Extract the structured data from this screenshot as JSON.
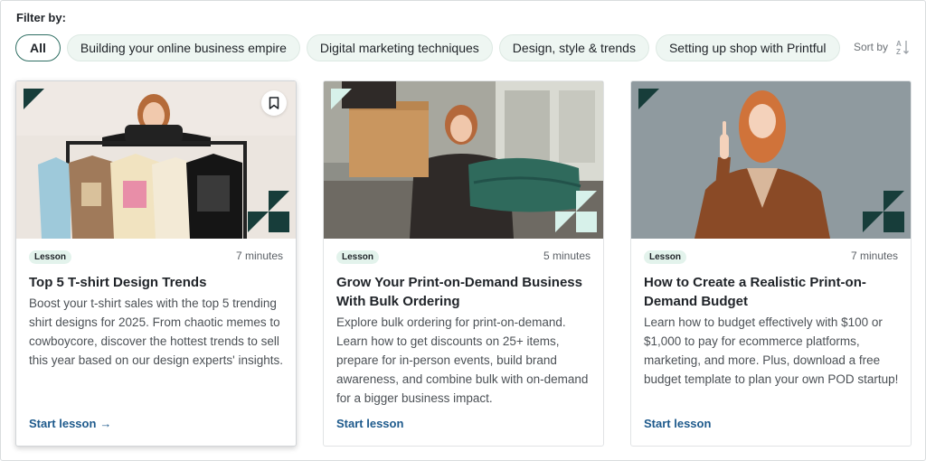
{
  "filter": {
    "label": "Filter by:",
    "chips": [
      {
        "label": "All",
        "active": true
      },
      {
        "label": "Building your online business empire",
        "active": false
      },
      {
        "label": "Digital marketing techniques",
        "active": false
      },
      {
        "label": "Design, style & trends",
        "active": false
      },
      {
        "label": "Setting up shop with Printful",
        "active": false
      }
    ],
    "sort_label": "Sort by",
    "sort_icon": "sort-az-icon"
  },
  "cards": [
    {
      "badge": "Lesson",
      "minutes": "7 minutes",
      "title": "Top 5 T-shirt Design Trends",
      "description": "Boost your t-shirt sales with the top 5 trending shirt designs for 2025. From chaotic memes to cowboycore, discover the hottest trends to sell this year based on our design experts' insights.",
      "cta": "Start lesson",
      "cta_arrow": "→",
      "image": "woman-with-tshirt-rack-photo",
      "bookmark_icon": "bookmark-icon"
    },
    {
      "badge": "Lesson",
      "minutes": "5 minutes",
      "title": "Grow Your Print-on-Demand Business With Bulk Ordering",
      "description": "Explore bulk ordering for print-on-demand. Learn how to get discounts on 25+ items, prepare for in-person events, build brand awareness, and combine bulk with on-demand for a bigger business impact.",
      "cta": "Start lesson",
      "image": "woman-with-box-and-shirts-photo"
    },
    {
      "badge": "Lesson",
      "minutes": "7 minutes",
      "title": "How to Create a Realistic Print-on-Demand Budget",
      "description": "Learn how to budget effectively with $100 or $1,000 to pay for ecommerce platforms, marketing, and more. Plus, download a free budget template to plan your own POD startup!",
      "cta": "Start lesson",
      "image": "woman-pointing-up-photo"
    }
  ],
  "colors": {
    "accent": "#1e5a8c",
    "chip_bg": "#eef6f2",
    "chip_active_border": "#2f6f63",
    "badge_bg": "#e3f3ec",
    "brand_dark": "#173d3a"
  }
}
